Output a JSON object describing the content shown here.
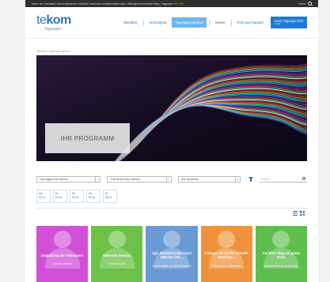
{
  "topbar": {
    "links": "tekom.de | Verband | tekom-akademie | tcworld | technical-communication-day | Intelligent Information Blog | Tagungen",
    "highlight": "DE | EN",
    "search_label": "Suche"
  },
  "header": {
    "logo_word_te": "te",
    "logo_word_kom": "kom",
    "logo_sub": "Tagungen",
    "nav": [
      {
        "label": "Überblick"
      },
      {
        "label": "Anmeldung"
      },
      {
        "label": "Tagungsprogramm"
      },
      {
        "label": "Messe"
      },
      {
        "label": "FAQ und Support"
      }
    ],
    "cta_label": "mein Tagungs-Tool",
    "cta_sub": "Login"
  },
  "breadcrumb": "Startseite / Tagungsprogramm",
  "hero": {
    "title": "IHR PROGRAMM"
  },
  "filters": {
    "format": "Vortragsformat wählen",
    "topic": "Themenbereich wählen",
    "language": "Alle Sprachen",
    "search_placeholder": "Suche"
  },
  "dates": [
    {
      "day": "Mo.",
      "date": "02.11."
    },
    {
      "day": "Di.",
      "date": "03.11."
    },
    {
      "day": "Mi.",
      "date": "04.11."
    },
    {
      "day": "Do.",
      "date": "05.11."
    },
    {
      "day": "Fr.",
      "date": "06.11."
    }
  ],
  "cards": [
    {
      "title": "Begrüßung der Teilnehmer",
      "speaker": "Carsten Weber",
      "color": "#d24fd8"
    },
    {
      "title": "Welcome Session",
      "speaker": "Thomas Groth",
      "color": "#6cc247"
    },
    {
      "title": "Agil, Standard oder eine? Welcher lieb...",
      "speaker": "Sandra Müller\nDr. Martin Kreuzer",
      "color": "#6a9ad6"
    },
    {
      "title": "5 Dinge, die Sie für virtuelle Meetings...",
      "speaker": "Petra Bauer\nJulia Reiter",
      "color": "#f0923a"
    },
    {
      "title": "Auf Ihrer Weg zur guten Doku",
      "speaker": "Michael Roth\nDr. Anja Keller",
      "color": "#5fbf4e"
    }
  ],
  "colors": {
    "brand": "#2b78c2",
    "nav_active": "#6fb6ea",
    "cta": "#1d7bd8"
  }
}
